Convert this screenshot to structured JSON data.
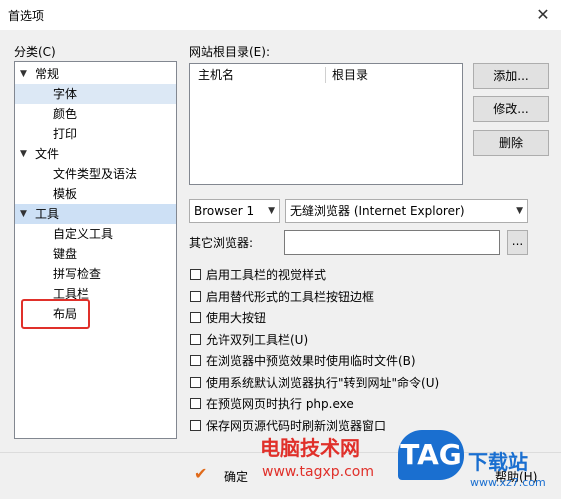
{
  "window": {
    "title": "首选项",
    "close_label": "✕"
  },
  "category_label": "分类(C)",
  "tree": [
    {
      "label": "常规",
      "level": 0,
      "expanded": true,
      "selected": false
    },
    {
      "label": "字体",
      "level": 1,
      "selected": true
    },
    {
      "label": "颜色",
      "level": 1,
      "selected": false
    },
    {
      "label": "打印",
      "level": 1,
      "selected": false
    },
    {
      "label": "文件",
      "level": 0,
      "expanded": true,
      "selected": false
    },
    {
      "label": "文件类型及语法",
      "level": 1,
      "selected": false
    },
    {
      "label": "模板",
      "level": 1,
      "selected": false
    },
    {
      "label": "工具",
      "level": 0,
      "expanded": true,
      "selected": true
    },
    {
      "label": "自定义工具",
      "level": 1,
      "selected": false
    },
    {
      "label": "键盘",
      "level": 1,
      "selected": false
    },
    {
      "label": "拼写检查",
      "level": 1,
      "selected": false
    },
    {
      "label": "工具栏",
      "level": 1,
      "selected": false
    },
    {
      "label": "布局",
      "level": 1,
      "selected": false
    }
  ],
  "site_root": {
    "label": "网站根目录(E):",
    "columns": [
      "主机名",
      "根目录"
    ],
    "buttons": {
      "add": "添加...",
      "edit": "修改...",
      "delete": "删除"
    }
  },
  "browser": {
    "slot_value": "Browser 1",
    "browser_value": "无缝浏览器 (Internet Explorer)",
    "other_label": "其它浏览器:",
    "other_value": "",
    "browse_label": "..."
  },
  "options": [
    {
      "label": "启用工具栏的视觉样式",
      "checked": false
    },
    {
      "label": "启用替代形式的工具栏按钮边框",
      "checked": false
    },
    {
      "label": "使用大按钮",
      "checked": false
    },
    {
      "label": "允许双列工具栏(U)",
      "checked": false
    },
    {
      "label": "在浏览器中预览效果时使用临时文件(B)",
      "checked": false
    },
    {
      "label": "使用系统默认浏览器执行\"转到网址\"命令(U)",
      "checked": false
    },
    {
      "label": "在预览网页时执行 php.exe",
      "checked": false
    },
    {
      "label": "保存网页源代码时刷新浏览器窗口",
      "checked": false
    }
  ],
  "footer": {
    "ok_label": "确定",
    "help_label": "帮助(H)"
  },
  "watermark": {
    "title": "电脑技术网",
    "url": "www.tagxp.com",
    "logo": "TAG",
    "cn": "下载站",
    "url2": "www.xz7.com"
  },
  "colors": {
    "selection": "#dce8f5",
    "highlight_box": "#e0302a",
    "watermark_blue": "#1a6fd0"
  }
}
